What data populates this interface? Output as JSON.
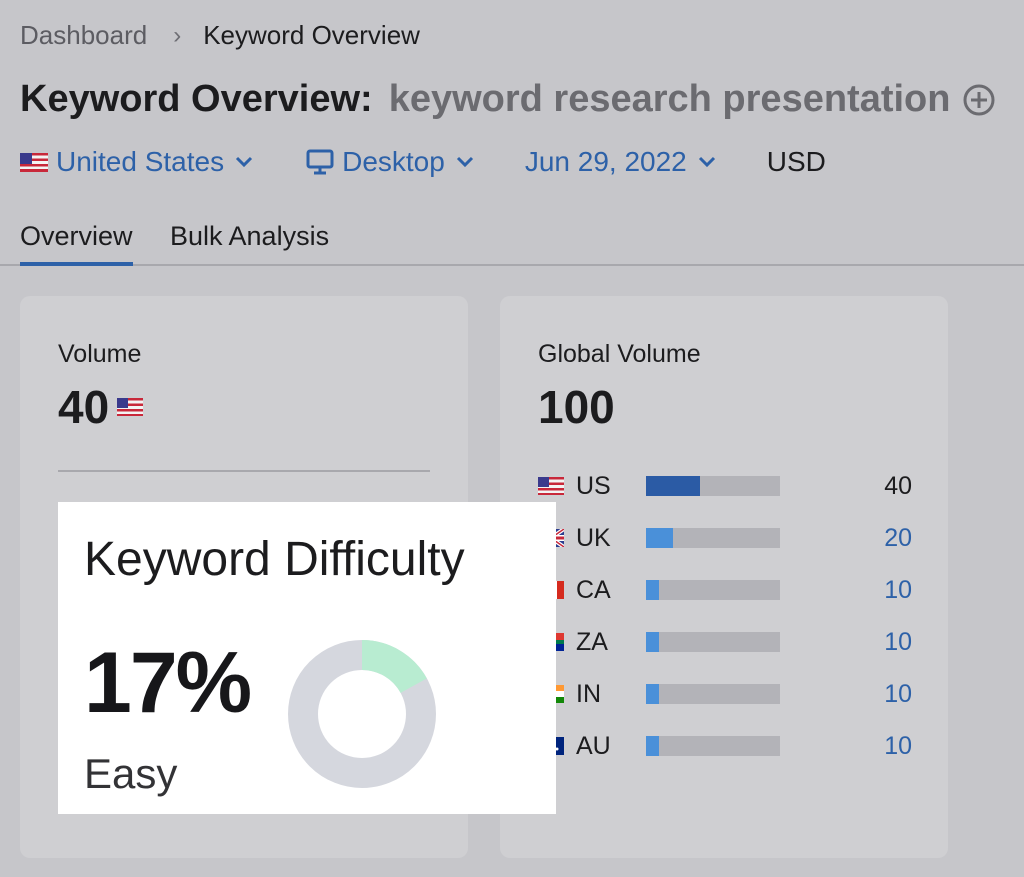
{
  "breadcrumb": {
    "home": "Dashboard",
    "current": "Keyword Overview"
  },
  "title": {
    "prefix": "Keyword Overview:",
    "keyword": "keyword research presentation"
  },
  "filters": {
    "country": "United States",
    "device": "Desktop",
    "date": "Jun 29, 2022",
    "currency": "USD"
  },
  "tabs": [
    "Overview",
    "Bulk Analysis"
  ],
  "volume": {
    "label": "Volume",
    "value": "40"
  },
  "global_volume": {
    "label": "Global Volume",
    "value": "100",
    "rows": [
      {
        "code": "US",
        "value": "40",
        "share": 0.4
      },
      {
        "code": "UK",
        "value": "20",
        "share": 0.2
      },
      {
        "code": "CA",
        "value": "10",
        "share": 0.1
      },
      {
        "code": "ZA",
        "value": "10",
        "share": 0.1
      },
      {
        "code": "IN",
        "value": "10",
        "share": 0.1
      },
      {
        "code": "AU",
        "value": "10",
        "share": 0.1
      }
    ]
  },
  "keyword_difficulty": {
    "title": "Keyword Difficulty",
    "value": "17%",
    "percent": 17,
    "level": "Easy",
    "color": "#b8ecd1",
    "track_color": "#d5d7de"
  },
  "colors": {
    "accent": "#2d61a8",
    "bar_fill": "#4a90d9",
    "bar_fill_top": "#2b5ba5",
    "bar_track": "#b3b3b8"
  }
}
